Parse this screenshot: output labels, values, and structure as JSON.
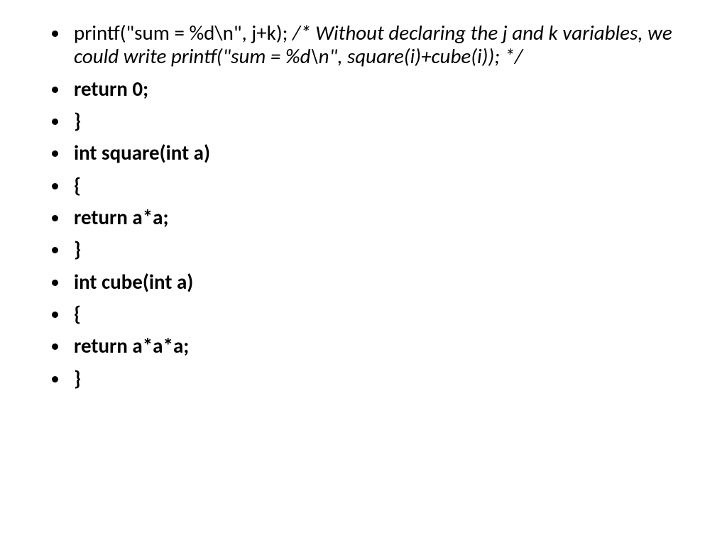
{
  "items": [
    {
      "normal": "printf(\"sum = %d\\n\", j+k); ",
      "italic": "/* Without declaring the j and k variables, we could write printf(\"sum = %d\\n\", square(i)+cube(i)); */"
    },
    {
      "bold": "return 0;"
    },
    {
      "bold": "}"
    },
    {
      "bold": "int square(int a)"
    },
    {
      "bold": "{"
    },
    {
      "bold": "return a*a;"
    },
    {
      "bold": "}"
    },
    {
      "bold": "int cube(int a)"
    },
    {
      "bold": "{"
    },
    {
      "bold": "return a*a*a;"
    },
    {
      "bold": "}"
    }
  ]
}
